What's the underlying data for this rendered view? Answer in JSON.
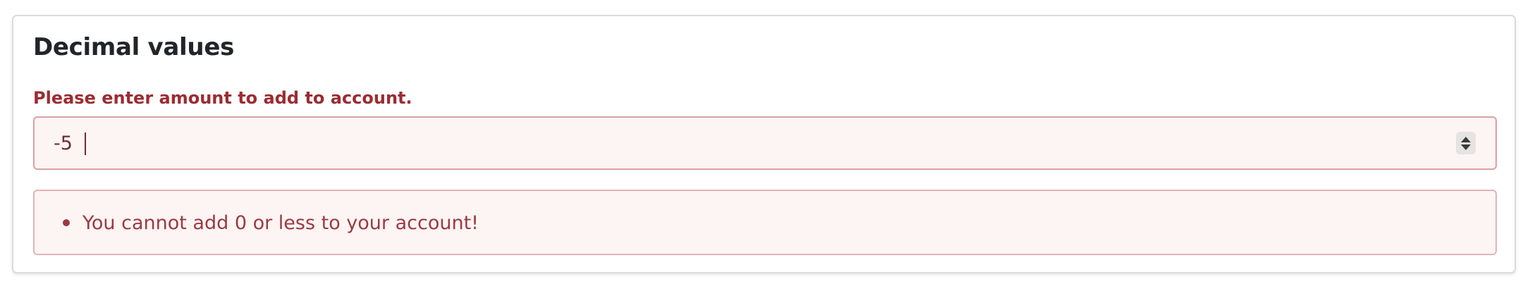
{
  "section": {
    "title": "Decimal values"
  },
  "amount_field": {
    "label": "Please enter amount to add to account.",
    "value": "-5"
  },
  "errors": {
    "items": [
      "You cannot add 0 or less to your account!"
    ]
  },
  "colors": {
    "error_text": "#9b2c32",
    "error_border": "#d9a1a6",
    "error_background": "#fdf4f4"
  }
}
